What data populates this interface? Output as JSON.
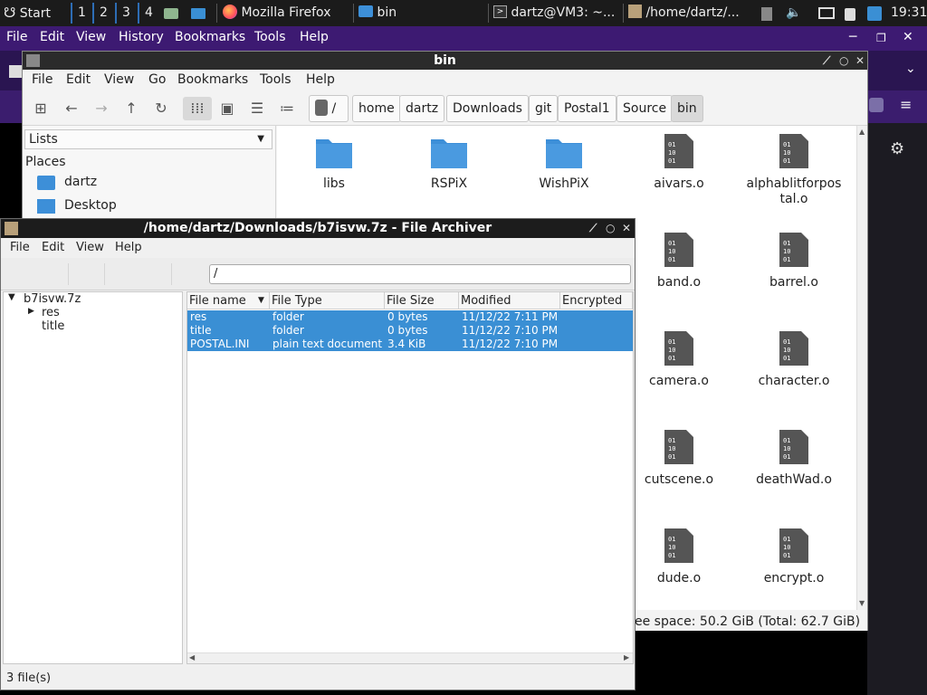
{
  "taskbar": {
    "start_label": "Start",
    "workspaces": [
      "1",
      "2",
      "3",
      "4"
    ],
    "tasks": [
      {
        "label": "Mozilla Firefox"
      },
      {
        "label": "bin"
      },
      {
        "label": "dartz@VM3: ~..."
      },
      {
        "label": "/home/dartz/..."
      }
    ],
    "clock": "19:31"
  },
  "firefox": {
    "menu": [
      "File",
      "Edit",
      "View",
      "History",
      "Bookmarks",
      "Tools",
      "Help"
    ]
  },
  "thunar": {
    "title": "bin",
    "menu": [
      "File",
      "Edit",
      "View",
      "Go",
      "Bookmarks",
      "Tools",
      "Help"
    ],
    "breadcrumbs": [
      "/",
      "home",
      "dartz",
      "Downloads",
      "git",
      "Postal1",
      "Source",
      "bin"
    ],
    "side_combo": "Lists",
    "places_heading": "Places",
    "places": [
      "dartz",
      "Desktop"
    ],
    "files": [
      "libs",
      "RSPiX",
      "WishPiX",
      "aivars.o",
      "alphablitforpostal.o",
      "band.o",
      "barrel.o",
      "camera.o",
      "character.o",
      "cutscene.o",
      "deathWad.o",
      "dude.o",
      "encrypt.o"
    ],
    "status": "ee space: 50.2 GiB (Total: 62.7 GiB)"
  },
  "archiver": {
    "title": "/home/dartz/Downloads/b7isvw.7z - File Archiver",
    "menu": [
      "File",
      "Edit",
      "View",
      "Help"
    ],
    "path": "/",
    "tree": {
      "root": "b7isvw.7z",
      "children": [
        "res",
        "title"
      ]
    },
    "columns": [
      "File name",
      "File Type",
      "File Size",
      "Modified",
      "Encrypted"
    ],
    "rows": [
      {
        "name": "res",
        "type": "folder",
        "size": "0 bytes",
        "modified": "11/12/22 7:11 PM"
      },
      {
        "name": "title",
        "type": "folder",
        "size": "0 bytes",
        "modified": "11/12/22 7:10 PM"
      },
      {
        "name": "POSTAL.INI",
        "type": "plain text document",
        "size": "3.4 KiB",
        "modified": "11/12/22 7:10 PM"
      }
    ],
    "status": "3 file(s)"
  },
  "colors": {
    "accent": "#3a8fd4",
    "folder": "#3d8fd8",
    "firefox_purple": "#3d1a72"
  }
}
